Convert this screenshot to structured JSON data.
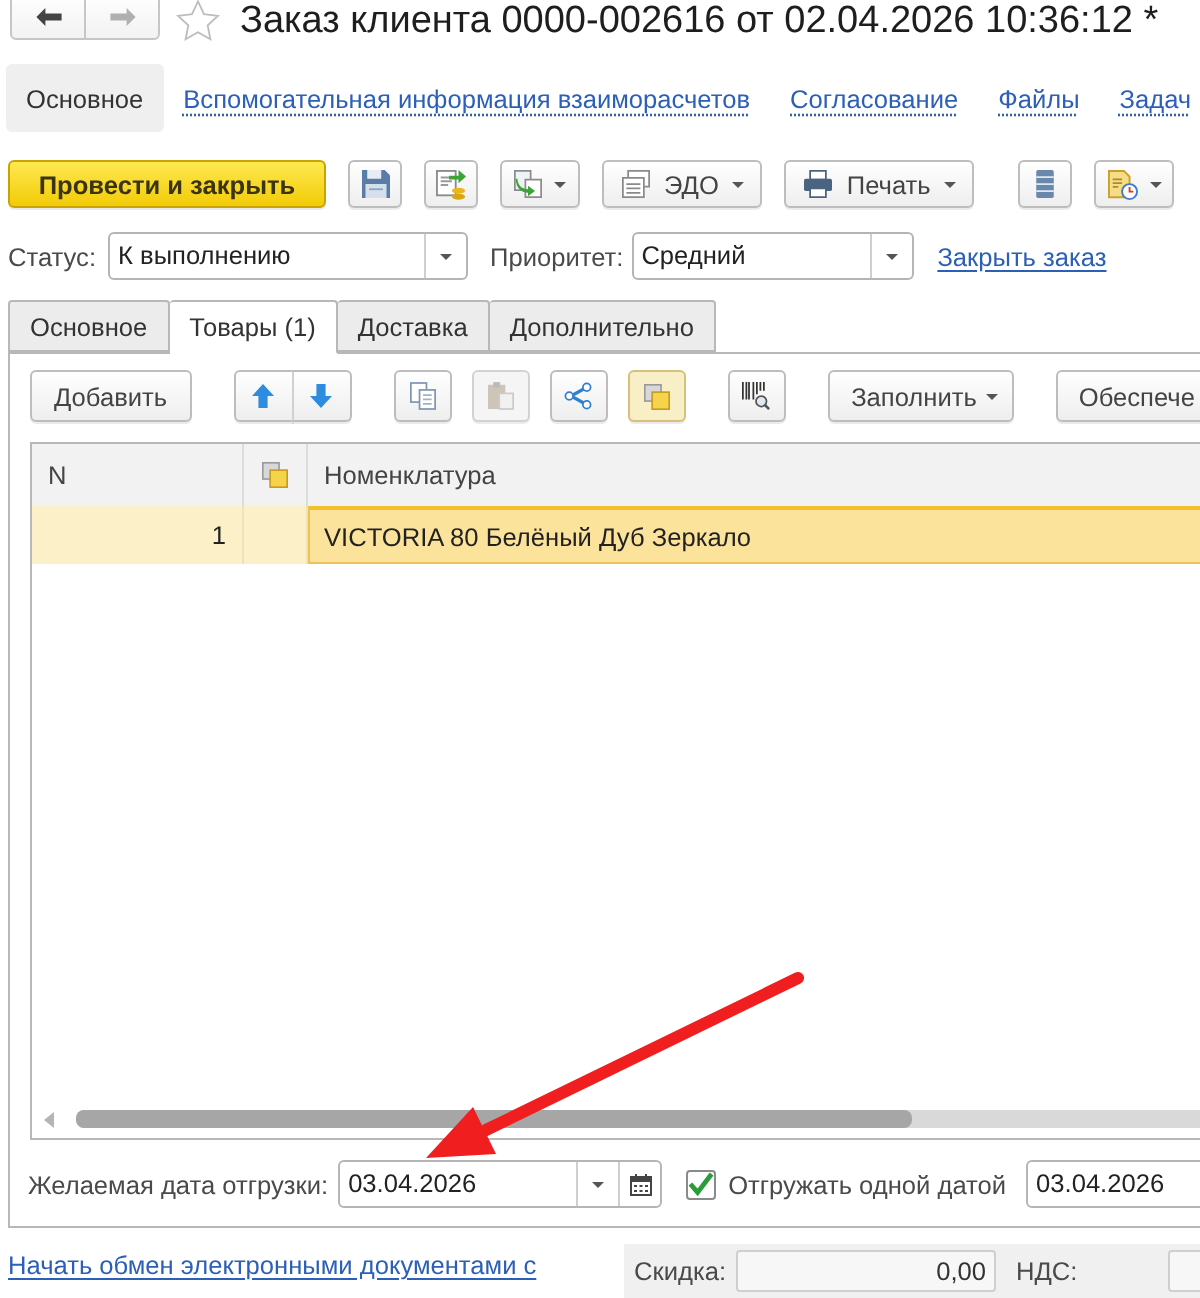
{
  "nav": [
    {
      "kind": "back",
      "disabled": false
    },
    {
      "kind": "forward",
      "disabled": true
    }
  ],
  "favorite": {
    "on": false
  },
  "window": {
    "title": "Заказ клиента 0000-002616 от 02.04.2026 10:36:12 *"
  },
  "sections": [
    {
      "label": "Основное",
      "selected": true
    },
    {
      "label": "Вспомогательная информация взаиморасчетов",
      "selected": false
    },
    {
      "label": "Согласование",
      "selected": false
    },
    {
      "label": "Файлы",
      "selected": false
    },
    {
      "label": "Задач",
      "selected": false
    }
  ],
  "toolbar": [
    {
      "kind": "primary",
      "label": "Провести и закрыть"
    },
    {
      "kind": "icon",
      "dropdown": false
    },
    {
      "kind": "icon",
      "dropdown": false
    },
    {
      "kind": "icon",
      "dropdown": true
    },
    {
      "kind": "labeled",
      "label": "ЭДО",
      "dropdown": true
    },
    {
      "kind": "labeled",
      "label": "Печать",
      "dropdown": true
    },
    {
      "kind": "icon",
      "dropdown": false
    },
    {
      "kind": "icon",
      "dropdown": true
    }
  ],
  "status": {
    "label": "Статус:",
    "value": "К выполнению"
  },
  "priority": {
    "label": "Приоритет:",
    "value": "Средний"
  },
  "close_order_link": "Закрыть заказ",
  "tabs": [
    {
      "label": "Основное",
      "selected": false
    },
    {
      "label": "Товары (1)",
      "selected": true
    },
    {
      "label": "Доставка",
      "selected": false
    },
    {
      "label": "Дополнительно",
      "selected": false
    }
  ],
  "goods": {
    "toolbar": [
      {
        "kind": "text",
        "label": "Добавить",
        "dropdown": false
      },
      {
        "kind": "updown"
      },
      {
        "kind": "icon",
        "disabled": false,
        "pressed": false
      },
      {
        "kind": "icon",
        "disabled": true,
        "pressed": false
      },
      {
        "kind": "icon",
        "disabled": false,
        "pressed": false
      },
      {
        "kind": "icon",
        "disabled": false,
        "pressed": true
      },
      {
        "kind": "icon",
        "disabled": false,
        "pressed": false
      },
      {
        "kind": "text",
        "label": "Заполнить",
        "dropdown": true
      },
      {
        "kind": "text",
        "label": "Обеспече"
      }
    ],
    "columns": [
      {
        "kind": "text",
        "label": "N"
      },
      {
        "kind": "icon"
      },
      {
        "kind": "text",
        "label": "Номенклатура"
      }
    ],
    "rows": [
      {
        "n": "1",
        "nomenclature": "VICTORIA 80 Белёный Дуб Зеркало",
        "selected": true
      }
    ]
  },
  "shipment": {
    "desired_date_label": "Желаемая дата отгрузки:",
    "desired_date": "03.04.2026",
    "single_date": {
      "label": "Отгружать одной датой",
      "checked": true
    },
    "single_date_value": "03.04.2026"
  },
  "edi_link": "Начать обмен электронными документами с",
  "totals": [
    {
      "label": "Скидка:",
      "value": "0,00"
    },
    {
      "label": "НДС:"
    }
  ],
  "annotation": {
    "kind": "arrow"
  }
}
